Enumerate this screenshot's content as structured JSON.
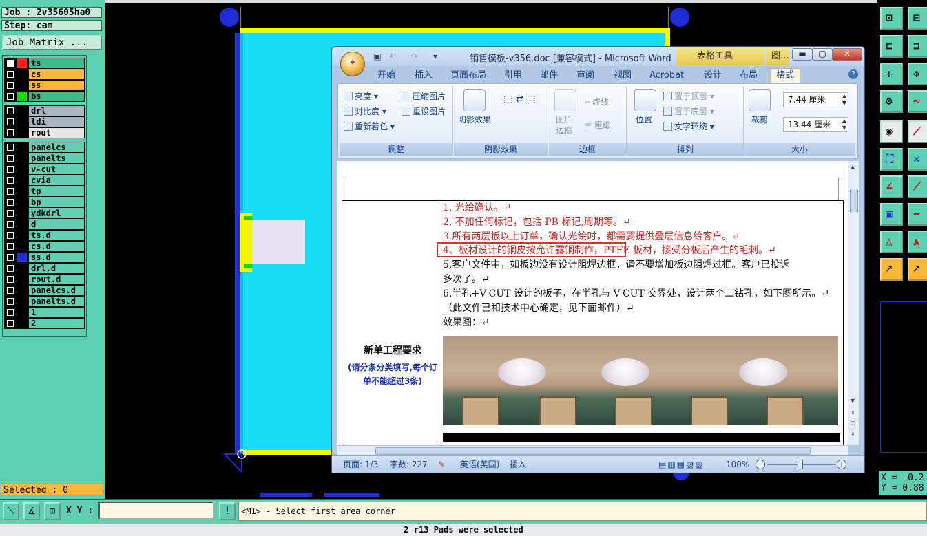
{
  "cam": {
    "job": "Job : 2v35605ha0",
    "step": "Step: cam",
    "job_matrix": "Job Matrix ...",
    "selected": "Selected : 0",
    "layers": [
      {
        "name": "ts",
        "color": "#ff1a1a",
        "name_bg": "#3fb98a",
        "checked": true
      },
      {
        "name": "cs",
        "color": "#000000",
        "name_bg": "#f7b83a",
        "checked": false
      },
      {
        "name": "ss",
        "color": "#000000",
        "name_bg": "#f7b83a",
        "checked": false
      },
      {
        "name": "bs",
        "color": "#10e010",
        "name_bg": "#3fb98a",
        "checked": false
      },
      {
        "name": "drl",
        "color": "#000000",
        "name_bg": "#a9b7c2",
        "checked": false
      },
      {
        "name": "ldi",
        "color": "#000000",
        "name_bg": "#a9b7c2",
        "checked": false
      },
      {
        "name": "rout",
        "color": "#000000",
        "name_bg": "#e4e4e4",
        "checked": false
      },
      {
        "name": "panelcs",
        "color": "#000000",
        "name_bg": "#5fcfb2",
        "checked": false
      },
      {
        "name": "panelts",
        "color": "#000000",
        "name_bg": "#5fcfb2",
        "checked": false
      },
      {
        "name": "v-cut",
        "color": "#000000",
        "name_bg": "#5fcfb2",
        "checked": false
      },
      {
        "name": "cvia",
        "color": "#000000",
        "name_bg": "#5fcfb2",
        "checked": false
      },
      {
        "name": "tp",
        "color": "#000000",
        "name_bg": "#5fcfb2",
        "checked": false
      },
      {
        "name": "bp",
        "color": "#000000",
        "name_bg": "#5fcfb2",
        "checked": false
      },
      {
        "name": "ydkdrl",
        "color": "#000000",
        "name_bg": "#5fcfb2",
        "checked": false
      },
      {
        "name": "d",
        "color": "#000000",
        "name_bg": "#5fcfb2",
        "checked": false
      },
      {
        "name": "ts.d",
        "color": "#000000",
        "name_bg": "#5fcfb2",
        "checked": false
      },
      {
        "name": "cs.d",
        "color": "#000000",
        "name_bg": "#5fcfb2",
        "checked": false
      },
      {
        "name": "ss.d",
        "color": "#1f2bd5",
        "name_bg": "#5fcfb2",
        "checked": false
      },
      {
        "name": "drl.d",
        "color": "#000000",
        "name_bg": "#5fcfb2",
        "checked": false
      },
      {
        "name": "rout.d",
        "color": "#000000",
        "name_bg": "#5fcfb2",
        "checked": false
      },
      {
        "name": "panelcs.d",
        "color": "#000000",
        "name_bg": "#5fcfb2",
        "checked": false
      },
      {
        "name": "panelts.d",
        "color": "#000000",
        "name_bg": "#5fcfb2",
        "checked": false
      },
      {
        "name": "1",
        "color": "#000000",
        "name_bg": "#5fcfb2",
        "checked": false
      },
      {
        "name": "2",
        "color": "#000000",
        "name_bg": "#5fcfb2",
        "checked": false
      }
    ],
    "xy_label": "X Y :",
    "xy_value": "",
    "prompt": "<M1> - Select first area corner",
    "status": "2 r13 Pads were selected",
    "coords": "X = -0.2\nY = 0.88"
  },
  "word": {
    "title": "销售模板-v356.doc [兼容模式] - Microsoft Word",
    "table_tools": "表格工具",
    "picture_tools": "图...",
    "tabs": [
      "开始",
      "插入",
      "页面布局",
      "引用",
      "邮件",
      "审阅",
      "视图",
      "Acrobat",
      "设计",
      "布局",
      "格式"
    ],
    "active_tab": "格式",
    "ribbon": {
      "adjust": {
        "label": "调整",
        "brightness": "亮度",
        "contrast": "对比度",
        "recolor": "重新着色",
        "compress": "压缩图片",
        "reset": "重设图片"
      },
      "shadow": {
        "label": "阴影效果",
        "shadow_btn": "阴影效果"
      },
      "border": {
        "label": "边框",
        "pic_border": "图片边框",
        "dashes": "虚线",
        "weight": "粗细"
      },
      "arrange": {
        "label": "排列",
        "position": "位置",
        "bring_front": "置于顶层",
        "send_back": "置于底层",
        "text_wrap": "文字环绕"
      },
      "size": {
        "label": "大小",
        "crop": "裁剪",
        "height": "7.44 厘米",
        "width": "13.44 厘米"
      }
    },
    "doc": {
      "req_title": "新单工程要求",
      "req_sub": "(请分条分类填写,每个订单不能超过3条)",
      "lines": [
        {
          "text": "1. 光绘确认。↵",
          "color": "red"
        },
        {
          "text": "2. 不加任何标记，包括 PB 标记,周期等。↵",
          "color": "red"
        },
        {
          "text": "3.所有两层板以上订单，确认光绘时，都需要提供叠层信息给客户。↵",
          "color": "red"
        },
        {
          "text": "4、板材设计的铜皮按允许露铜制作，PTFE 板材，接受分板后产生的毛刺。↵",
          "color": "red"
        },
        {
          "text": "5.客户文件中，如板边没有设计阻焊边框，请不要增加板边阻焊过框。客户已投诉",
          "color": "black"
        },
        {
          "text": "多次了。↵",
          "color": "black"
        },
        {
          "text": "6.半孔+V-CUT 设计的板子，在半孔与 V-CUT 交界处，设计两个二钻孔，如下图所示。↵",
          "color": "black"
        },
        {
          "text": "（此文件已和技术中心确定，见下面邮件）↵",
          "color": "black"
        },
        {
          "text": "效果图：↵",
          "color": "black"
        }
      ]
    },
    "status": {
      "page": "页面: 1/3",
      "words": "字数: 227",
      "lang": "英语(美国)",
      "mode": "插入",
      "zoom": "100%"
    }
  },
  "colors": {
    "panel": "#5fcfb2",
    "board_fill": "#19dcf5",
    "board_border": "#f5f500",
    "board_side": "#1f2bd5",
    "accent_orange": "#f7b83a"
  }
}
